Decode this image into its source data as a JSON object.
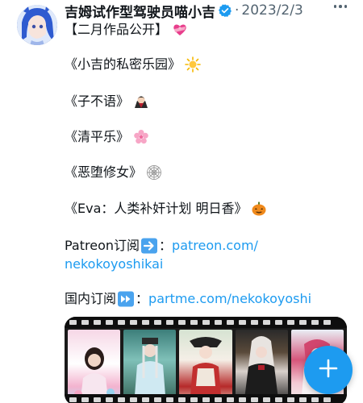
{
  "tweet": {
    "author": {
      "display_name": "吉姆试作型驾驶员喵小吉",
      "verified_icon": "verified-badge-icon",
      "separator": "·",
      "date": "2023/2/3"
    },
    "lines": [
      {
        "text": "【二月作品公开】",
        "emoji": "heart-with-ribbon-icon"
      },
      {
        "text": "《小吉的私密乐园》",
        "emoji": "sun-icon"
      },
      {
        "text": "《子不语》",
        "emoji": "vampire-icon"
      },
      {
        "text": "《清平乐》",
        "emoji": "cherry-blossom-icon"
      },
      {
        "text": "《恶堕修女》",
        "emoji": "spider-web-icon"
      },
      {
        "text": "《Eva：人类补奸计划 明日香》",
        "emoji": "jack-o-lantern-icon"
      }
    ],
    "patreon": {
      "label": "Patreon订阅",
      "arrow_icon": "right-arrow-button-icon",
      "colon": "：",
      "link_part1": "patreon.com/",
      "link_part2": "nekokoyoshikai"
    },
    "domestic": {
      "label": "国内订阅",
      "arrow_icon": "fast-forward-button-icon",
      "colon": "：",
      "link": "partme.com/nekokoyoshi"
    },
    "media": {
      "frame_count": 5
    }
  },
  "fab": {
    "icon": "plus-icon"
  },
  "colors": {
    "link": "#1d9bf0",
    "text": "#0f1419",
    "muted": "#536471",
    "fab": "#1d9bf0"
  }
}
